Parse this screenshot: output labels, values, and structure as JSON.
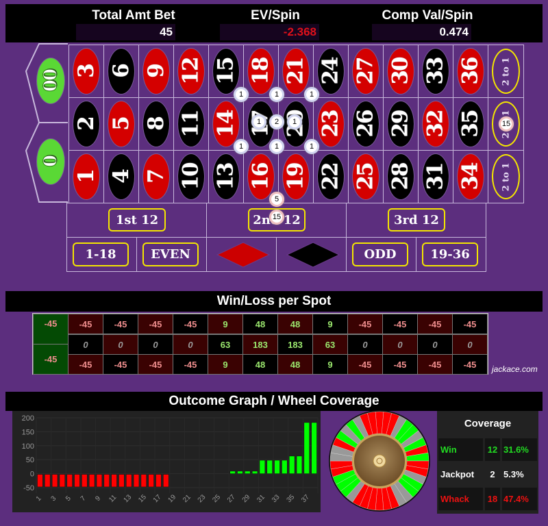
{
  "header": {
    "total_bet_label": "Total Amt Bet",
    "total_bet_value": "45",
    "ev_label": "EV/Spin",
    "ev_value": "-2.368",
    "comp_label": "Comp Val/Spin",
    "comp_value": "0.474"
  },
  "board": {
    "zeros": [
      "00",
      "0"
    ],
    "rows": [
      [
        {
          "n": "3",
          "c": "red"
        },
        {
          "n": "6",
          "c": "black"
        },
        {
          "n": "9",
          "c": "red"
        },
        {
          "n": "12",
          "c": "red"
        },
        {
          "n": "15",
          "c": "black"
        },
        {
          "n": "18",
          "c": "red"
        },
        {
          "n": "21",
          "c": "red"
        },
        {
          "n": "24",
          "c": "black"
        },
        {
          "n": "27",
          "c": "red"
        },
        {
          "n": "30",
          "c": "red"
        },
        {
          "n": "33",
          "c": "black"
        },
        {
          "n": "36",
          "c": "red"
        }
      ],
      [
        {
          "n": "2",
          "c": "black"
        },
        {
          "n": "5",
          "c": "red"
        },
        {
          "n": "8",
          "c": "black"
        },
        {
          "n": "11",
          "c": "black"
        },
        {
          "n": "14",
          "c": "red"
        },
        {
          "n": "17",
          "c": "black"
        },
        {
          "n": "20",
          "c": "black"
        },
        {
          "n": "23",
          "c": "red"
        },
        {
          "n": "26",
          "c": "black"
        },
        {
          "n": "29",
          "c": "black"
        },
        {
          "n": "32",
          "c": "red"
        },
        {
          "n": "35",
          "c": "black"
        }
      ],
      [
        {
          "n": "1",
          "c": "red"
        },
        {
          "n": "4",
          "c": "black"
        },
        {
          "n": "7",
          "c": "red"
        },
        {
          "n": "10",
          "c": "black"
        },
        {
          "n": "13",
          "c": "black"
        },
        {
          "n": "16",
          "c": "red"
        },
        {
          "n": "19",
          "c": "red"
        },
        {
          "n": "22",
          "c": "black"
        },
        {
          "n": "25",
          "c": "red"
        },
        {
          "n": "28",
          "c": "black"
        },
        {
          "n": "31",
          "c": "black"
        },
        {
          "n": "34",
          "c": "red"
        }
      ]
    ],
    "column_bets": [
      "2 to 1",
      "2 to 1",
      "2 to 1"
    ],
    "dozens": [
      "1st 12",
      "2nd 12",
      "3rd 12"
    ],
    "outside": [
      "1-18",
      "EVEN",
      "red",
      "black",
      "ODD",
      "19-36"
    ],
    "chips": [
      {
        "label": "1",
        "spot": "corner 14-15-17-18"
      },
      {
        "label": "1",
        "spot": "corner 17-18-20-21"
      },
      {
        "label": "1",
        "spot": "corner 20-21-23-24"
      },
      {
        "label": "1",
        "spot": "split 14-17"
      },
      {
        "label": "2",
        "spot": "split 17-20"
      },
      {
        "label": "1",
        "spot": "split 20-23"
      },
      {
        "label": "1",
        "spot": "corner 13-14-16-17"
      },
      {
        "label": "1",
        "spot": "corner 16-17-19-20"
      },
      {
        "label": "1",
        "spot": "corner 19-20-22-23"
      },
      {
        "label": "5",
        "spot": "split 16-19 edge"
      },
      {
        "label": "15",
        "spot": "2nd 12"
      },
      {
        "label": "15",
        "spot": "2nd column 2 to 1"
      }
    ]
  },
  "winloss": {
    "title": "Win/Loss per Spot",
    "zeros": [
      "-45",
      "-45"
    ],
    "rows": [
      [
        "-45",
        "-45",
        "-45",
        "-45",
        "9",
        "48",
        "48",
        "9",
        "-45",
        "-45",
        "-45",
        "-45"
      ],
      [
        "0",
        "0",
        "0",
        "0",
        "63",
        "183",
        "183",
        "63",
        "0",
        "0",
        "0",
        "0"
      ],
      [
        "-45",
        "-45",
        "-45",
        "-45",
        "9",
        "48",
        "48",
        "9",
        "-45",
        "-45",
        "-45",
        "-45"
      ]
    ],
    "watermark": "jackace.com"
  },
  "outcome": {
    "title": "Outcome Graph / Wheel Coverage"
  },
  "chart_data": {
    "type": "bar",
    "title": "",
    "xlabel": "",
    "ylabel": "",
    "ylim": [
      -50,
      200
    ],
    "yticks": [
      200,
      150,
      100,
      50,
      0,
      -50
    ],
    "xticks": [
      "1",
      "3",
      "5",
      "7",
      "9",
      "11",
      "13",
      "15",
      "17",
      "19",
      "21",
      "23",
      "25",
      "27",
      "29",
      "31",
      "33",
      "35",
      "37"
    ],
    "categories": [
      "1",
      "2",
      "3",
      "4",
      "5",
      "6",
      "7",
      "8",
      "9",
      "10",
      "11",
      "12",
      "13",
      "14",
      "15",
      "16",
      "17",
      "18",
      "19",
      "20",
      "21",
      "22",
      "23",
      "24",
      "25",
      "26",
      "27",
      "28",
      "29",
      "30",
      "31",
      "32",
      "33",
      "34",
      "35",
      "36",
      "37",
      "38"
    ],
    "values": [
      -45,
      -45,
      -45,
      -45,
      -45,
      -45,
      -45,
      -45,
      -45,
      -45,
      -45,
      -45,
      -45,
      -45,
      -45,
      -45,
      -45,
      -45,
      0,
      0,
      0,
      0,
      0,
      0,
      0,
      0,
      9,
      9,
      9,
      9,
      48,
      48,
      48,
      48,
      63,
      63,
      183,
      183
    ],
    "colors": {
      "negative": "#ff0000",
      "positive": "#00ff00"
    },
    "grid": true
  },
  "wheel": {
    "segments": [
      "red",
      "red",
      "red",
      "gray",
      "green",
      "green",
      "gray",
      "green",
      "red",
      "green",
      "red",
      "red",
      "gray",
      "green",
      "green",
      "gray",
      "gray",
      "red",
      "red",
      "red",
      "red",
      "red",
      "red",
      "gray",
      "green",
      "green",
      "green",
      "red",
      "red",
      "gray",
      "gray",
      "red",
      "green",
      "gray",
      "green",
      "gray",
      "red",
      "red"
    ],
    "colors": {
      "red": "#ff0000",
      "green": "#00ff00",
      "gray": "#999999"
    }
  },
  "coverage": {
    "title": "Coverage",
    "rows": [
      {
        "label": "Win",
        "count": "12",
        "pct": "31.6%",
        "color": "#22dd22"
      },
      {
        "label": "Jackpot",
        "count": "2",
        "pct": "5.3%",
        "color": "#ffffff"
      },
      {
        "label": "Whack",
        "count": "18",
        "pct": "47.4%",
        "color": "#ee1111"
      }
    ]
  }
}
